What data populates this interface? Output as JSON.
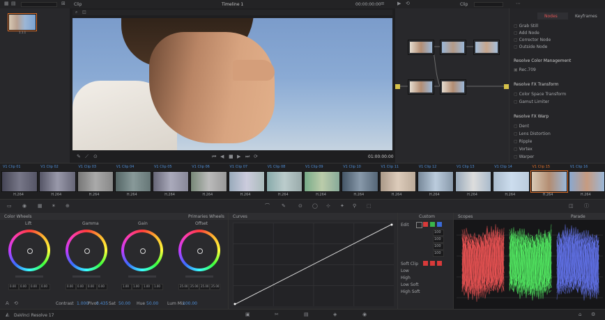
{
  "top_bar": {
    "left_label": "Clip",
    "project_title": "Timeline 1",
    "timecode": "00:00:00:00",
    "right_label": "Clip",
    "tab_nodes": "Nodes",
    "tab_keyframes": "Keyframes"
  },
  "viewer": {
    "timecode": "01:00:00:00"
  },
  "side_panel": {
    "group1_items": [
      "Grab Still",
      "Add Node",
      "Corrector Node",
      "Outside Node"
    ],
    "section_color_space": "Resolve Color Management",
    "color_space_item": "Rec.709",
    "section_lut": "Resolve FX Transform",
    "lut_items": [
      "Color Space Transform",
      "Gamut Limiter"
    ],
    "section_warp": "Resolve FX Warp",
    "warp_items": [
      "Dent",
      "Lens Distortion",
      "Ripple",
      "Vortex",
      "Warper"
    ]
  },
  "timeline": {
    "clip_labels": [
      "V1 Clip 01",
      "V1 Clip 02",
      "V1 Clip 03",
      "V1 Clip 04",
      "V1 Clip 05",
      "V1 Clip 06",
      "V1 Clip 07",
      "V1 Clip 08",
      "V1 Clip 09",
      "V1 Clip 10",
      "V1 Clip 11",
      "V1 Clip 12",
      "V1 Clip 13",
      "V1 Clip 14",
      "V1 Clip 15",
      "V1 Clip 16"
    ],
    "codec": "H.264"
  },
  "color_wheels": {
    "panel_title": "Color Wheels",
    "mode": "Primaries Wheels",
    "wheels": [
      {
        "name": "Lift",
        "values": [
          "0.00",
          "0.00",
          "0.00",
          "0.00"
        ]
      },
      {
        "name": "Gamma",
        "values": [
          "0.00",
          "0.00",
          "0.00",
          "0.00"
        ]
      },
      {
        "name": "Gain",
        "values": [
          "1.00",
          "1.00",
          "1.00",
          "1.00"
        ]
      },
      {
        "name": "Offset",
        "values": [
          "25.00",
          "25.00",
          "25.00",
          "25.00"
        ]
      }
    ],
    "bottom": {
      "contrast_label": "Contrast",
      "contrast_value": "1.000",
      "pivot_label": "Pivot",
      "pivot_value": "0.435",
      "sat_label": "Sat",
      "sat_value": "50.00",
      "hue_label": "Hue",
      "hue_value": "50.00",
      "lum_mix_label": "Lum Mix",
      "lum_mix_value": "100.00"
    }
  },
  "curves": {
    "title": "Curves"
  },
  "custom_panel": {
    "title": "Custom",
    "edit_label": "Edit",
    "values": [
      "100",
      "100",
      "100",
      "100"
    ],
    "soft_clip_label": "Soft Clip",
    "rows": [
      "Low",
      "High",
      "Low Soft",
      "High Soft"
    ]
  },
  "scopes": {
    "title": "Scopes",
    "mode": "Parade"
  },
  "status_bar": {
    "app_name": "DaVinci Resolve 17"
  },
  "colors": {
    "accent_orange": "#e0702a",
    "accent_blue": "#4f8fd8",
    "parade_red": "#ff5a5a",
    "parade_green": "#5aff6a",
    "parade_blue": "#6a7cff"
  }
}
